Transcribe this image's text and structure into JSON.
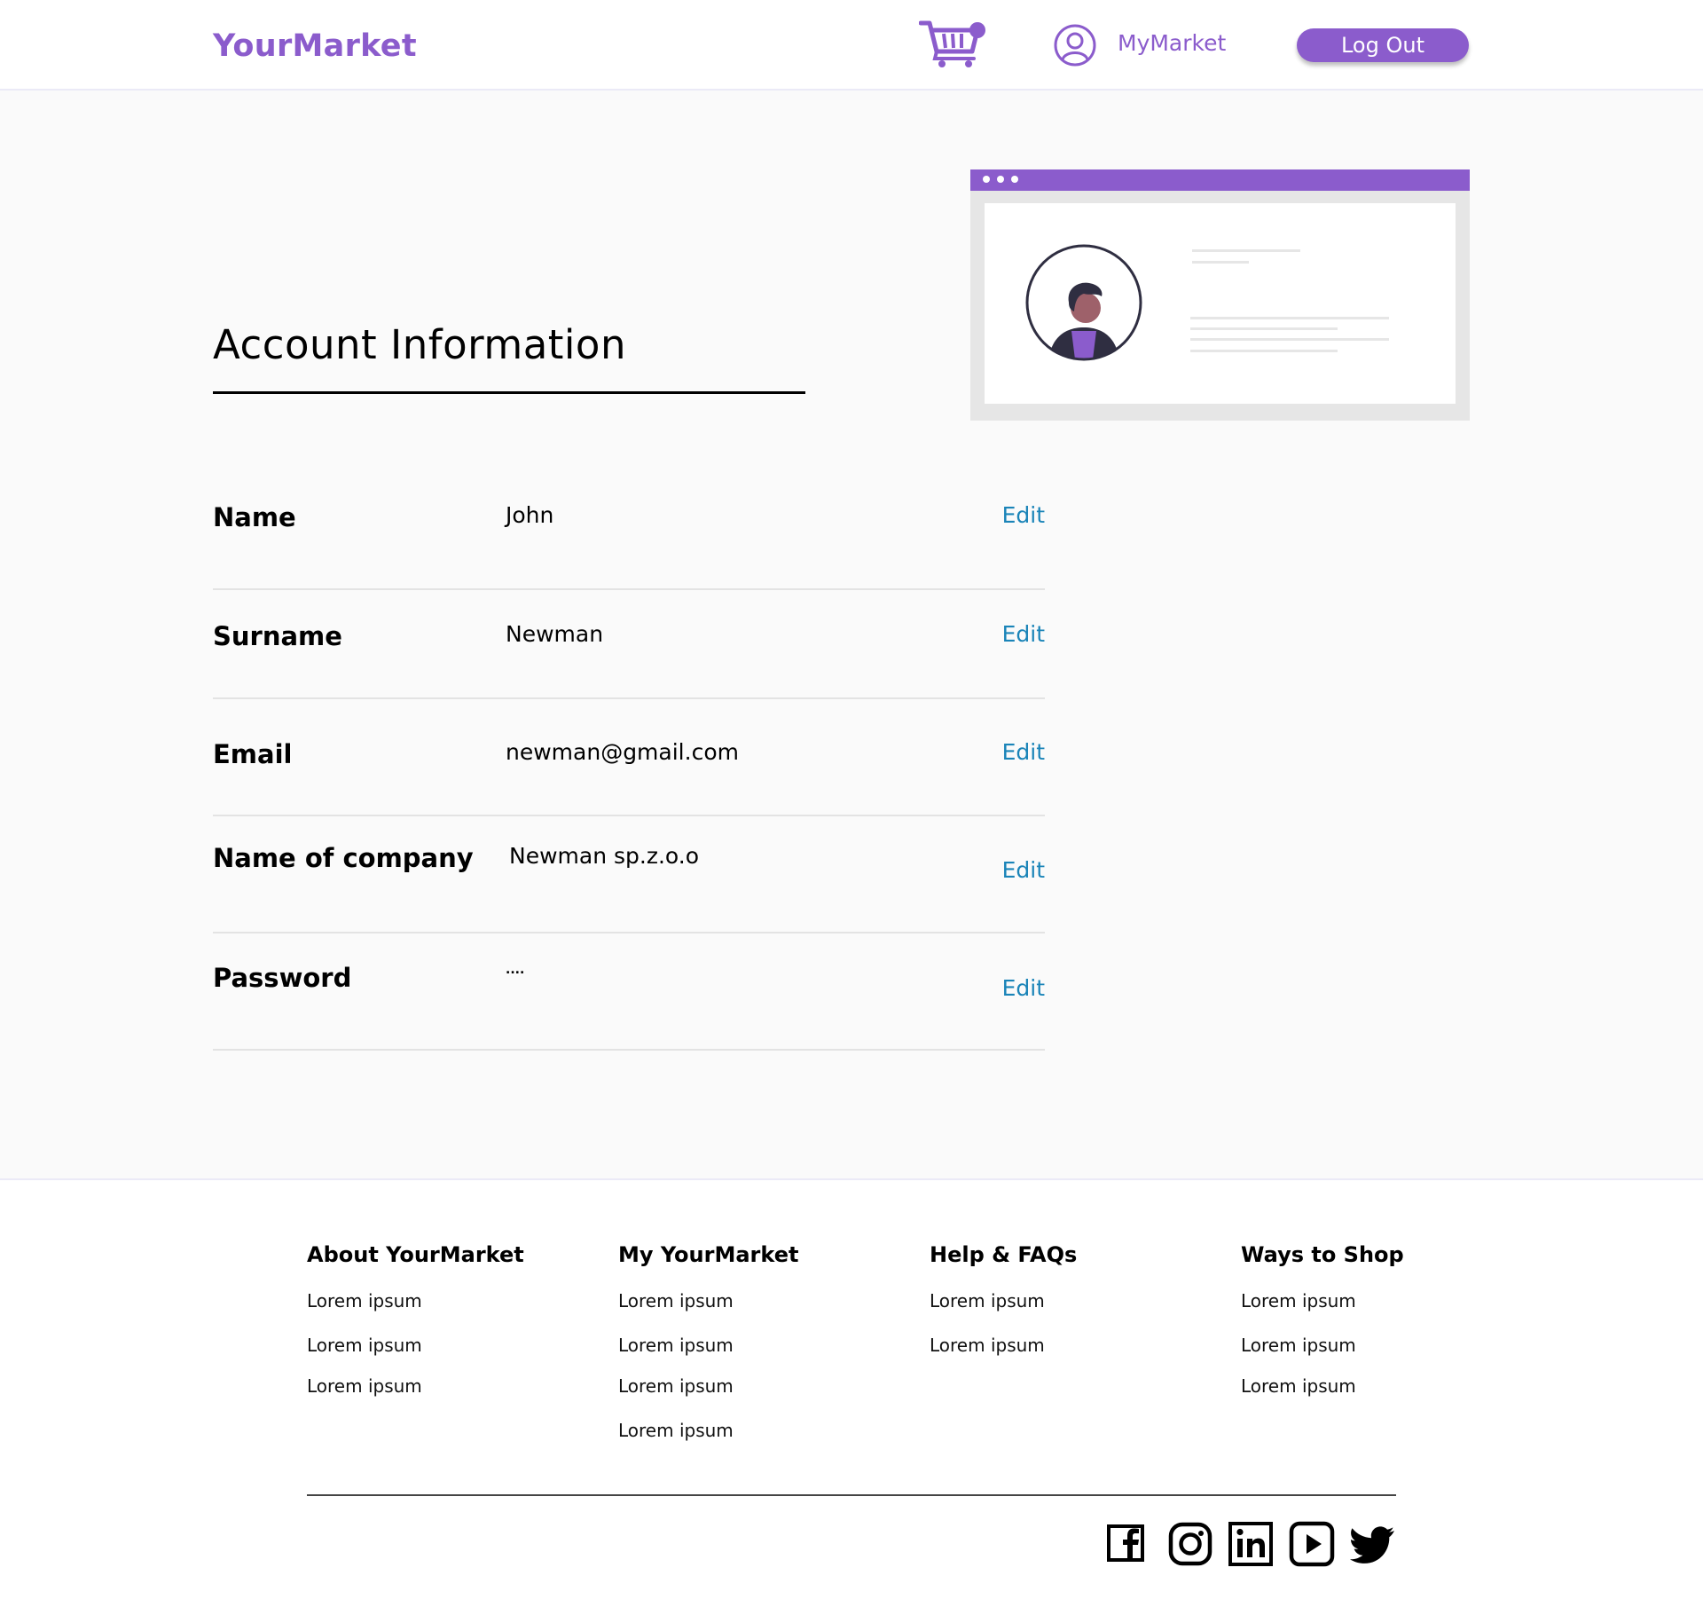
{
  "header": {
    "brand": "YourMarket",
    "account_link": "MyMarket",
    "logout_label": "Log Out"
  },
  "main": {
    "title": "Account Information",
    "fields": [
      {
        "label": "Name",
        "value": "John",
        "action": "Edit"
      },
      {
        "label": "Surname",
        "value": "Newman",
        "action": "Edit"
      },
      {
        "label": "Email",
        "value": "newman@gmail.com",
        "action": "Edit"
      },
      {
        "label": "Name of company",
        "value": "Newman sp.z.o.o",
        "action": "Edit"
      },
      {
        "label": "Password",
        "value": "....",
        "action": "Edit"
      }
    ]
  },
  "footer": {
    "columns": [
      {
        "heading": "About YourMarket",
        "links": [
          "Lorem ipsum",
          "Lorem ipsum",
          "Lorem ipsum"
        ]
      },
      {
        "heading": "My YourMarket",
        "links": [
          "Lorem ipsum",
          "Lorem ipsum",
          "Lorem ipsum",
          "Lorem ipsum"
        ]
      },
      {
        "heading": "Help & FAQs",
        "links": [
          "Lorem ipsum",
          "Lorem ipsum"
        ]
      },
      {
        "heading": "Ways to Shop",
        "links": [
          "Lorem ipsum",
          "Lorem ipsum",
          "Lorem ipsum"
        ]
      }
    ],
    "social": [
      "facebook-icon",
      "instagram-icon",
      "linkedin-icon",
      "youtube-icon",
      "twitter-icon"
    ]
  },
  "colors": {
    "accent": "#8b5ccc",
    "link": "#1a84b8",
    "divider": "#e3e3e3",
    "background": "#fafafa"
  }
}
